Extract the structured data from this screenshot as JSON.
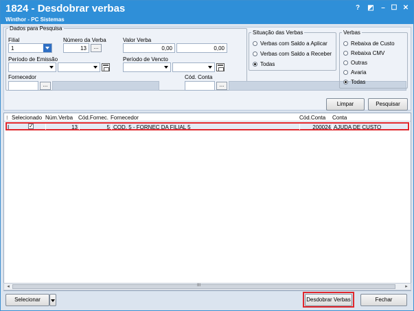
{
  "window": {
    "title": "1824 - Desdobrar verbas",
    "subtitle": "Winthor - PC Sistemas",
    "controls": [
      "?",
      "◩",
      "–",
      "☐",
      "✕"
    ]
  },
  "filters": {
    "group_label": "Dados para Pesquisa",
    "filial": {
      "label": "Filial",
      "value": "1"
    },
    "numero_verba": {
      "label": "Número da Verba",
      "value": "13",
      "button": "..."
    },
    "valor_verba": {
      "label": "Valor Verba",
      "from": "0,00",
      "to": "0,00"
    },
    "periodo_emissao": {
      "label": "Período de Emissão",
      "from": "",
      "to": ""
    },
    "periodo_vencto": {
      "label": "Período de Vencto",
      "from": "",
      "to": ""
    },
    "fornecedor": {
      "label": "Fornecedor",
      "code": "",
      "button": "...",
      "name": ""
    },
    "cod_conta": {
      "label": "Cód. Conta",
      "code": "",
      "button": "...",
      "name": ""
    }
  },
  "situacao": {
    "label": "Situação das Verbas",
    "options": [
      "Verbas com Saldo a Aplicar",
      "Verbas com Saldo a Receber",
      "Todas"
    ],
    "selected": "Todas"
  },
  "verbas": {
    "label": "Verbas",
    "options": [
      "Rebaixa de Custo",
      "Rebaixa CMV",
      "Outras",
      "Avaria",
      "Todas"
    ],
    "selected": "Todas"
  },
  "actions": {
    "limpar": "Limpar",
    "pesquisar": "Pesquisar"
  },
  "grid": {
    "columns": [
      "Selecionado",
      "Núm.Verba",
      "Cód.Fornec.",
      "Fornecedor",
      "Cód.Conta",
      "Conta"
    ],
    "rows": [
      {
        "indicator": "I",
        "selecionado": "✓",
        "num_verba": "13",
        "cod_fornec": "5",
        "fornecedor": "COD. 5 - FORNEC DA FILIAL 5",
        "cod_conta": "200024",
        "conta": "AJUDA DE CUSTO"
      }
    ],
    "scroll_thumb": "III"
  },
  "footer": {
    "selecionar": "Selecionar",
    "desdobrar": "Desdobrar Verbas",
    "fechar": "Fechar"
  },
  "colors": {
    "titlebar": "#2f8fd8",
    "highlight": "#e0262c",
    "background": "#dbe4ef"
  }
}
